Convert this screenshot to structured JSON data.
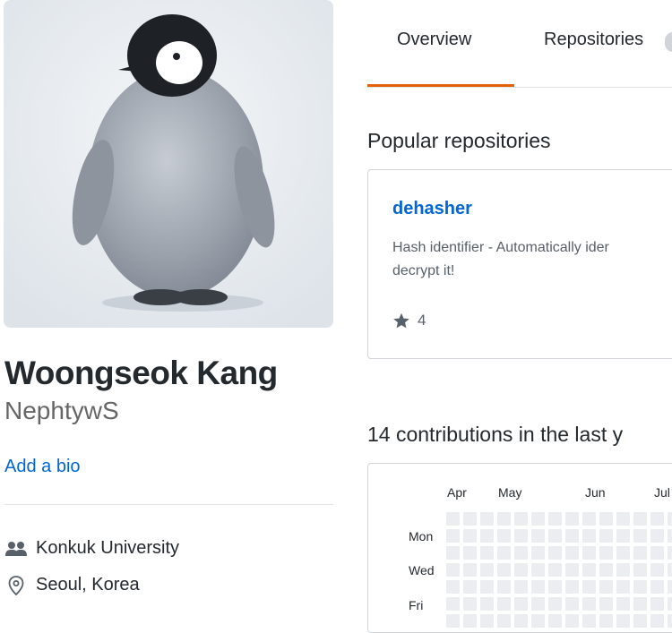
{
  "profile": {
    "full_name": "Woongseok Kang",
    "username": "NephtywS",
    "add_bio": "Add a bio",
    "organization": "Konkuk University",
    "location": "Seoul, Korea",
    "org_icon": "people-icon",
    "location_icon": "location-pin-icon"
  },
  "tabs": [
    {
      "label": "Overview",
      "selected": true
    },
    {
      "label": "Repositories",
      "selected": false
    }
  ],
  "popular": {
    "title": "Popular repositories",
    "repos": [
      {
        "name": "dehasher",
        "description": "Hash identifier - Automatically ider\ndecrypt it!",
        "stars": "4",
        "star_icon": "star-icon"
      }
    ]
  },
  "contributions": {
    "title": "14 contributions in the last y",
    "months": [
      "Apr",
      "May",
      "Jun",
      "Jul"
    ],
    "days": [
      "Mon",
      "Wed",
      "Fri"
    ]
  },
  "colors": {
    "accent_tab": "#e36209",
    "link": "#0366d6",
    "cell_empty": "#ebedf0"
  }
}
